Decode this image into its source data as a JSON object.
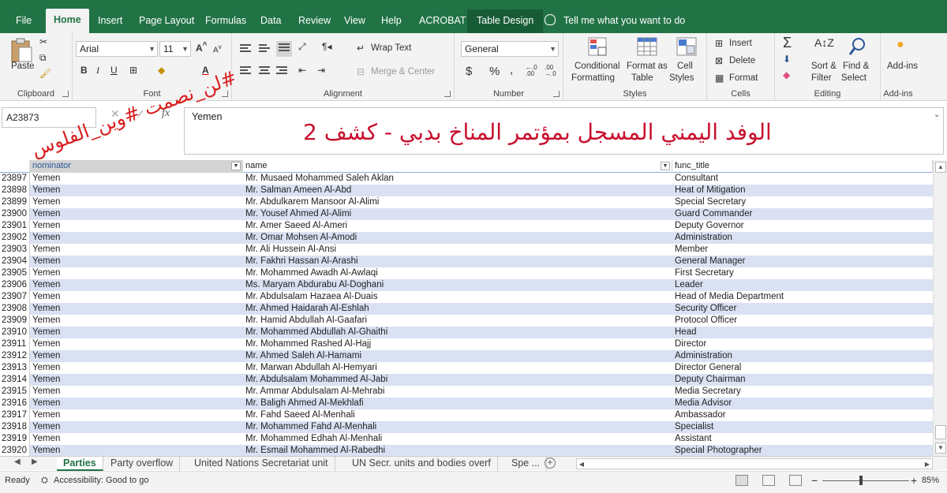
{
  "ribbon_tabs": [
    "File",
    "Home",
    "Insert",
    "Page Layout",
    "Formulas",
    "Data",
    "Review",
    "View",
    "Help",
    "ACROBAT",
    "Table Design"
  ],
  "tell_me": "Tell me what you want to do",
  "ribbon": {
    "clipboard": {
      "paste": "Paste",
      "label": "Clipboard"
    },
    "font": {
      "name": "Arial",
      "size": "11",
      "label": "Font"
    },
    "alignment": {
      "wrap": "Wrap Text",
      "merge": "Merge & Center",
      "label": "Alignment"
    },
    "number": {
      "format": "General",
      "label": "Number"
    },
    "styles": {
      "conditional": "Conditional",
      "formatting": "Formatting",
      "format_as": "Format as",
      "table": "Table",
      "cell": "Cell",
      "styles_word": "Styles",
      "label": "Styles"
    },
    "cells": {
      "insert": "Insert",
      "delete": "Delete",
      "format": "Format",
      "label": "Cells"
    },
    "editing": {
      "sort": "Sort &",
      "filter": "Filter",
      "find": "Find &",
      "select": "Select",
      "label": "Editing"
    },
    "addins": {
      "btn": "Add-ins",
      "label": "Add-ins"
    }
  },
  "formula_bar": {
    "name_box": "A23873",
    "value": "Yemen",
    "fx": "fx"
  },
  "overlay": {
    "arabic_title": "الوفد اليمني المسجل بمؤتمر المناخ بدبي  - كشف 2",
    "hashtag": "#لن_نصمت #وين_الفلوس"
  },
  "columns": [
    "nominator",
    "name",
    "func_title"
  ],
  "rows": [
    {
      "n": "23897",
      "nom": "Yemen",
      "name": "Mr. Musaed Mohammed Saleh Aklan",
      "title": "Consultant"
    },
    {
      "n": "23898",
      "nom": "Yemen",
      "name": "Mr. Salman Ameen Al-Abd",
      "title": "Heat of Mitigation"
    },
    {
      "n": "23899",
      "nom": "Yemen",
      "name": "Mr. Abdulkarem Mansoor Al-Alimi",
      "title": "Special Secretary"
    },
    {
      "n": "23900",
      "nom": "Yemen",
      "name": "Mr. Yousef Ahmed Al-Alimi",
      "title": "Guard Commander"
    },
    {
      "n": "23901",
      "nom": "Yemen",
      "name": "Mr. Amer Saeed Al-Ameri",
      "title": "Deputy Governor"
    },
    {
      "n": "23902",
      "nom": "Yemen",
      "name": "Mr. Omar Mohsen Al-Amodi",
      "title": "Administration"
    },
    {
      "n": "23903",
      "nom": "Yemen",
      "name": "Mr. Ali Hussein Al-Ansi",
      "title": "Member"
    },
    {
      "n": "23904",
      "nom": "Yemen",
      "name": "Mr. Fakhri Hassan Al-Arashi",
      "title": "General Manager"
    },
    {
      "n": "23905",
      "nom": "Yemen",
      "name": "Mr. Mohammed Awadh Al-Awlaqi",
      "title": "First Secretary"
    },
    {
      "n": "23906",
      "nom": "Yemen",
      "name": "Ms. Maryam Abdurabu Al-Doghani",
      "title": "Leader"
    },
    {
      "n": "23907",
      "nom": "Yemen",
      "name": "Mr. Abdulsalam Hazaea Al-Duais",
      "title": "Head of Media Department"
    },
    {
      "n": "23908",
      "nom": "Yemen",
      "name": "Mr. Ahmed Haidarah Al-Eshlah",
      "title": "Security Officer"
    },
    {
      "n": "23909",
      "nom": "Yemen",
      "name": "Mr. Hamid Abdullah Al-Gaafari",
      "title": "Protocol Officer"
    },
    {
      "n": "23910",
      "nom": "Yemen",
      "name": "Mr. Mohammed Abdullah Al-Ghaithi",
      "title": "Head"
    },
    {
      "n": "23911",
      "nom": "Yemen",
      "name": "Mr. Mohammed Rashed Al-Hajj",
      "title": "Director"
    },
    {
      "n": "23912",
      "nom": "Yemen",
      "name": "Mr. Ahmed Saleh Al-Hamami",
      "title": "Administration"
    },
    {
      "n": "23913",
      "nom": "Yemen",
      "name": "Mr. Marwan Abdullah Al-Hemyari",
      "title": "Director General"
    },
    {
      "n": "23914",
      "nom": "Yemen",
      "name": "Mr. Abdulsalam Mohammed Al-Jabi",
      "title": "Deputy Chairman"
    },
    {
      "n": "23915",
      "nom": "Yemen",
      "name": "Mr. Ammar Abdulsalam Al-Mehrabi",
      "title": "Media Secretary"
    },
    {
      "n": "23916",
      "nom": "Yemen",
      "name": "Mr. Baligh Ahmed Al-Mekhlafi",
      "title": "Media Advisor"
    },
    {
      "n": "23917",
      "nom": "Yemen",
      "name": "Mr. Fahd Saeed Al-Menhali",
      "title": "Ambassador"
    },
    {
      "n": "23918",
      "nom": "Yemen",
      "name": "Mr. Mohammed Fahd Al-Menhali",
      "title": "Specialist"
    },
    {
      "n": "23919",
      "nom": "Yemen",
      "name": "Mr. Mohammed Edhah Al-Menhali",
      "title": "Assistant"
    },
    {
      "n": "23920",
      "nom": "Yemen",
      "name": "Mr. Esmail Mohammed Al-Rabedhi",
      "title": "Special Photographer"
    }
  ],
  "sheet_tabs": [
    "Parties",
    "Party overflow",
    "United Nations Secretariat unit",
    "UN Secr. units and bodies overf",
    "Spe ..."
  ],
  "status": {
    "ready": "Ready",
    "accessibility": "Accessibility: Good to go",
    "zoom": "85%"
  },
  "colors": {
    "excel_green": "#217346",
    "band": "#d9e1f2",
    "title_red": "#c8102e"
  }
}
